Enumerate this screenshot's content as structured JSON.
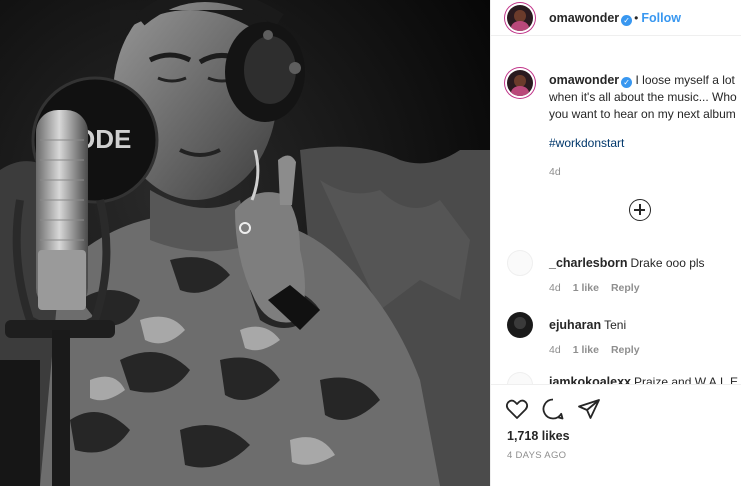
{
  "post": {
    "username": "omawonder",
    "follow_label": "Follow",
    "separator": "•",
    "caption_lines": [
      "I loose myself a lot",
      "when it's all about the music... Who",
      "you want to hear on my next album"
    ],
    "hashtag": "#workdonstart",
    "caption_age": "4d",
    "likes": "1,718 likes",
    "posted": "4 DAYS AGO",
    "photo_brand_text": "ODE"
  },
  "comments": [
    {
      "user": "_charlesborn",
      "text": "Drake ooo pls",
      "age": "4d",
      "likes": "1 like",
      "reply": "Reply",
      "avatar": "blank"
    },
    {
      "user": "ejuharan",
      "text": "Teni",
      "age": "4d",
      "likes": "1 like",
      "reply": "Reply",
      "avatar": "dark"
    },
    {
      "user": "iamkokoalexx",
      "text": "Praize and W.A.L.E",
      "age": "",
      "likes": "",
      "reply": "",
      "avatar": "blank"
    }
  ],
  "icons": {
    "verified": "verified-badge-icon",
    "heart": "heart-icon",
    "comment": "comment-icon",
    "share": "share-icon",
    "load_more": "plus-circle-icon"
  },
  "colors": {
    "link_blue": "#3897f0",
    "hashtag": "#00376b",
    "muted": "#8e8e8e",
    "text": "#262626",
    "story_ring": "#c1358a"
  }
}
